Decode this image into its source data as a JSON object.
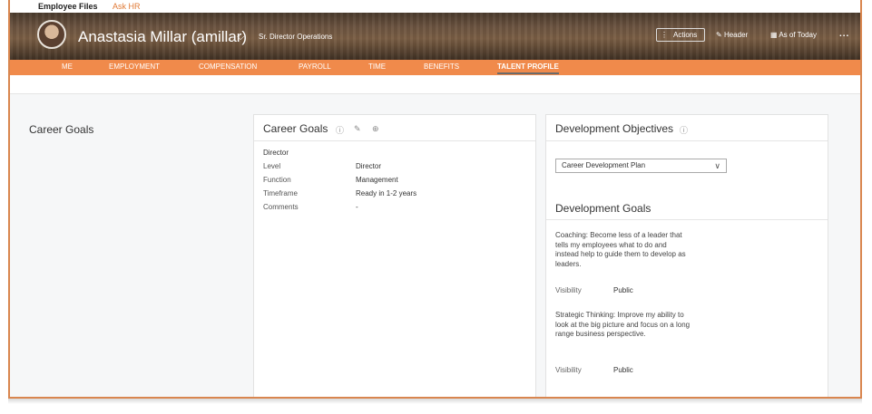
{
  "topnav": {
    "employee_files": "Employee Files",
    "ask_hr": "Ask HR"
  },
  "header": {
    "name": "Anastasia Millar (amillar)",
    "position": "Sr. Director Operations",
    "actions_label": "Actions",
    "header_label": "Header",
    "as_of_label": "As of Today",
    "more_label": "..."
  },
  "tabs": [
    {
      "label": "ME"
    },
    {
      "label": "EMPLOYMENT"
    },
    {
      "label": "COMPENSATION"
    },
    {
      "label": "PAYROLL"
    },
    {
      "label": "TIME"
    },
    {
      "label": "BENEFITS"
    },
    {
      "label": "TALENT PROFILE",
      "active": true
    }
  ],
  "section_label": "Career Goals",
  "career_goals": {
    "title": "Career Goals",
    "goal_name": "Director",
    "rows": [
      {
        "label": "Level",
        "value": "Director"
      },
      {
        "label": "Function",
        "value": "Management"
      },
      {
        "label": "Timeframe",
        "value": "Ready in 1-2 years"
      },
      {
        "label": "Comments",
        "value": "-"
      }
    ]
  },
  "development": {
    "objectives_title": "Development Objectives",
    "plan_select": "Career Development Plan",
    "goals_title": "Development Goals",
    "goals": [
      {
        "text": "Coaching: Become less of a leader that tells my employees what to do and instead help to guide them to develop as leaders.",
        "visibility_label": "Visibility",
        "visibility": "Public"
      },
      {
        "text": "Strategic Thinking: Improve my ability to look at the big picture and focus on a long range business perspective.",
        "visibility_label": "Visibility",
        "visibility": "Public"
      }
    ]
  },
  "colors": {
    "accent": "#f08a4b",
    "link": "#e07a36"
  }
}
